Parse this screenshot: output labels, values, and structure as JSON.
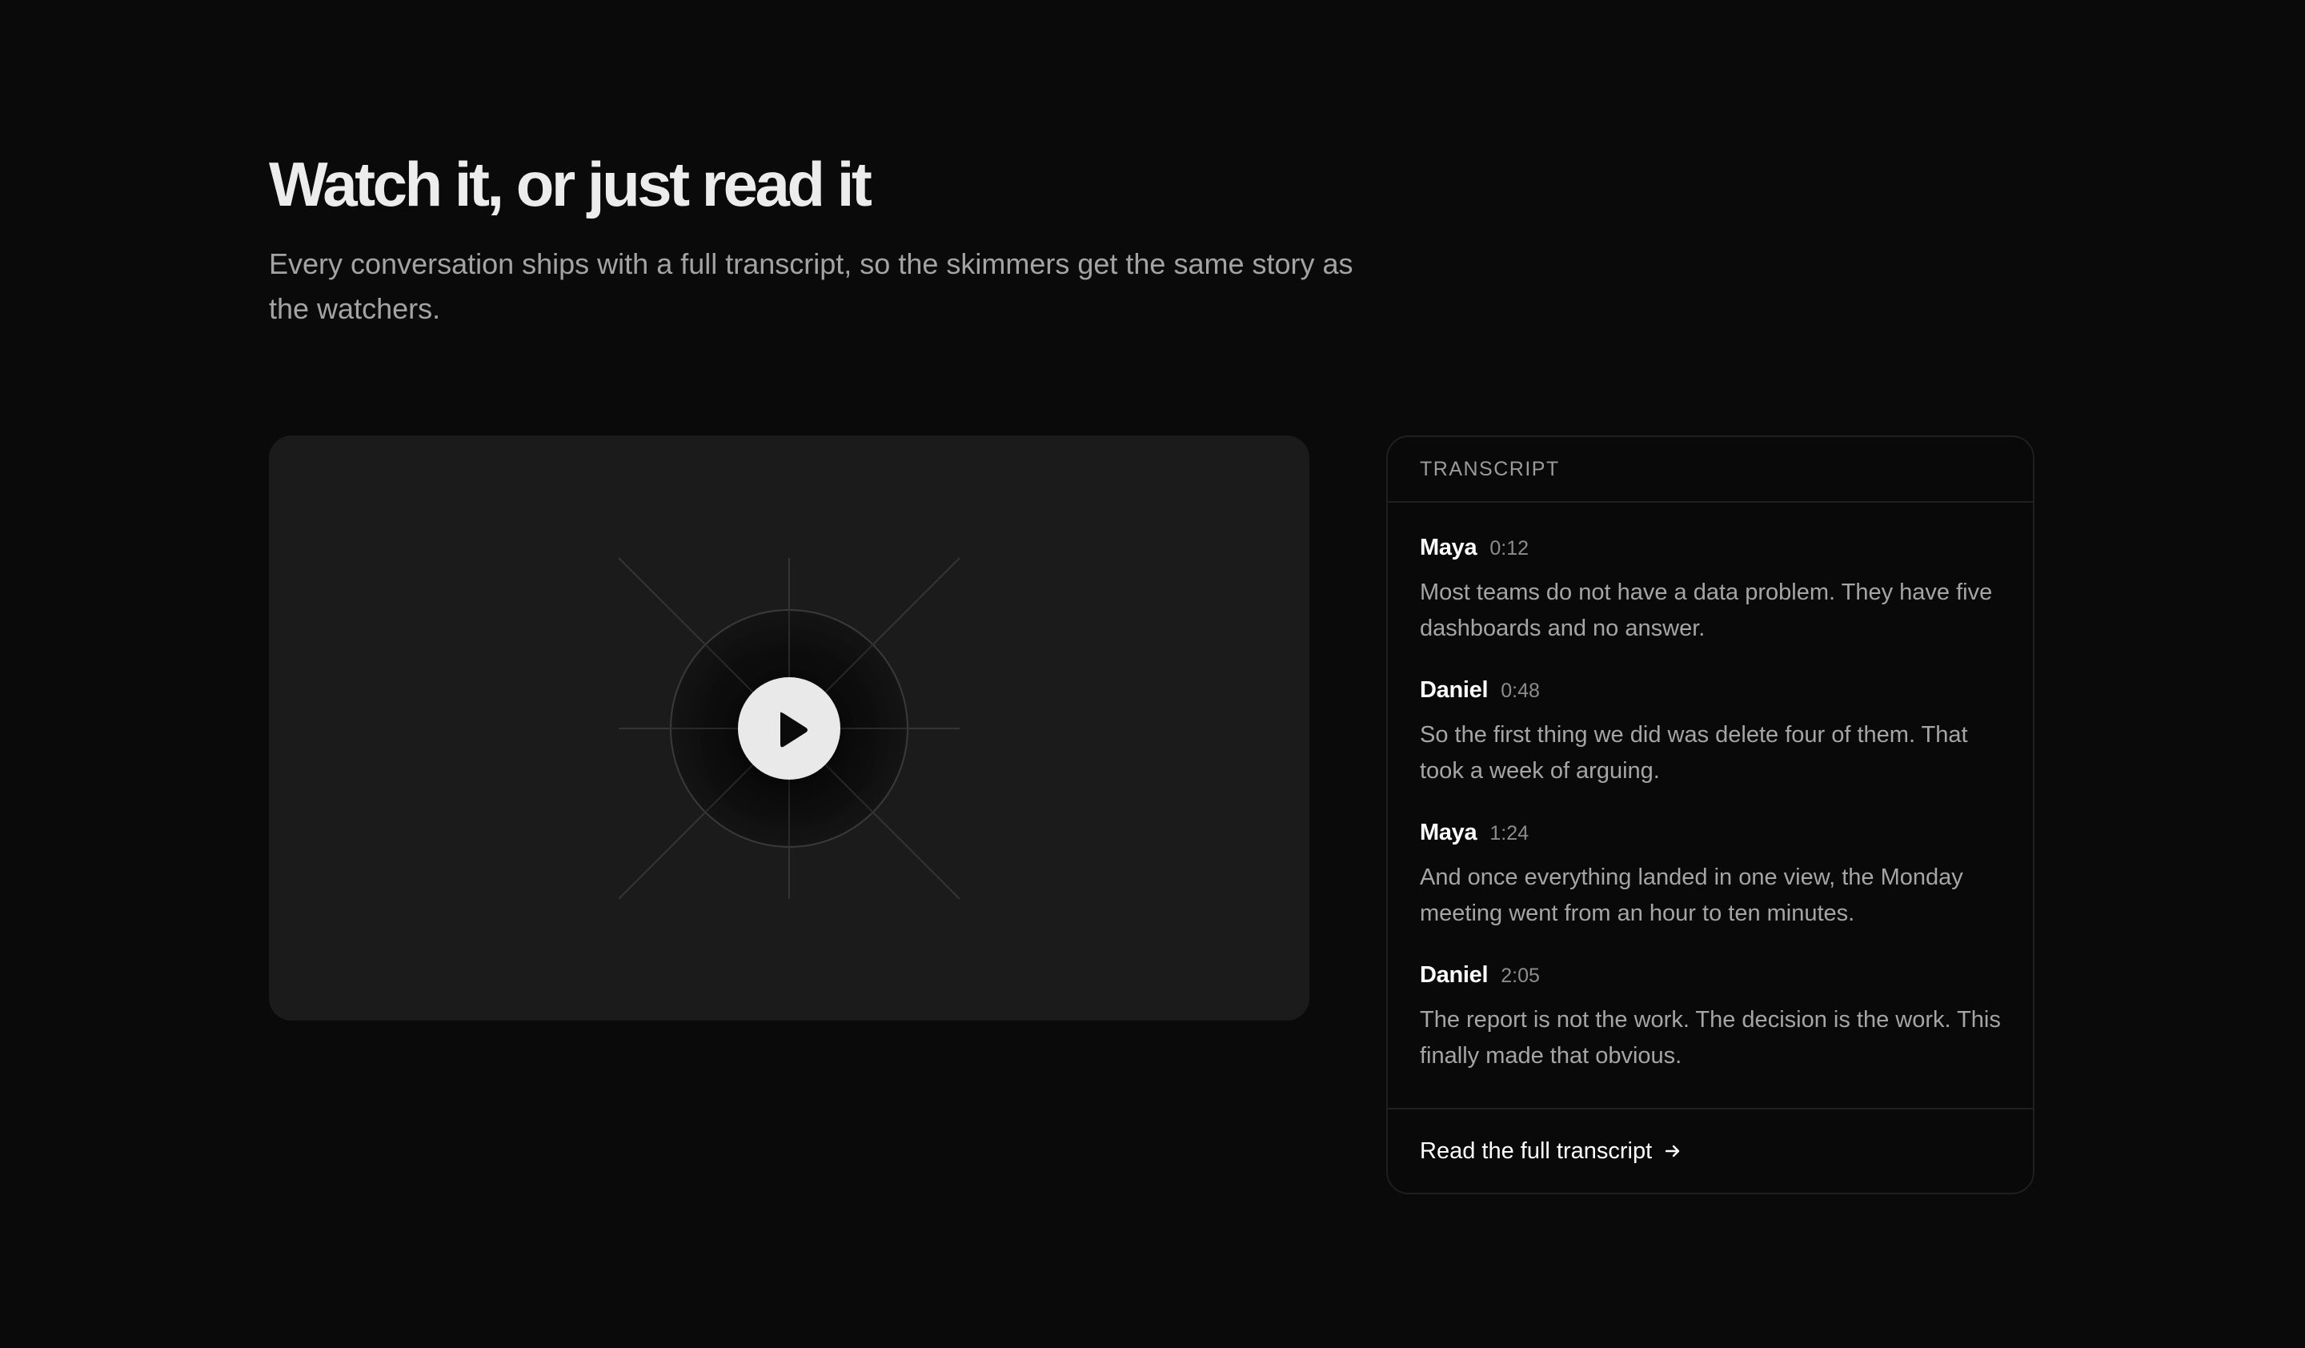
{
  "section": {
    "title": "Watch it, or just read it",
    "subtitle": "Every conversation ships with a full transcript, so the skimmers get the same story as the watchers."
  },
  "video": {
    "play_icon": "play-icon"
  },
  "transcript": {
    "header": "TRANSCRIPT",
    "entries": [
      {
        "speaker": "Maya",
        "time": "0:12",
        "text": "Most teams do not have a data problem. They have five dashboards and no answer."
      },
      {
        "speaker": "Daniel",
        "time": "0:48",
        "text": "So the first thing we did was delete four of them. That took a week of arguing."
      },
      {
        "speaker": "Maya",
        "time": "1:24",
        "text": "And once everything landed in one view, the Monday meeting went from an hour to ten minutes."
      },
      {
        "speaker": "Daniel",
        "time": "2:05",
        "text": "The report is not the work. The decision is the work. This finally made that obvious."
      }
    ],
    "footer_link": "Read the full transcript",
    "footer_icon": "arrow-right-icon"
  },
  "colors": {
    "background": "#0a0a0a",
    "video_panel": "#1b1b1b",
    "play_button": "#e9e9e9",
    "border": "#1f1f1f"
  }
}
